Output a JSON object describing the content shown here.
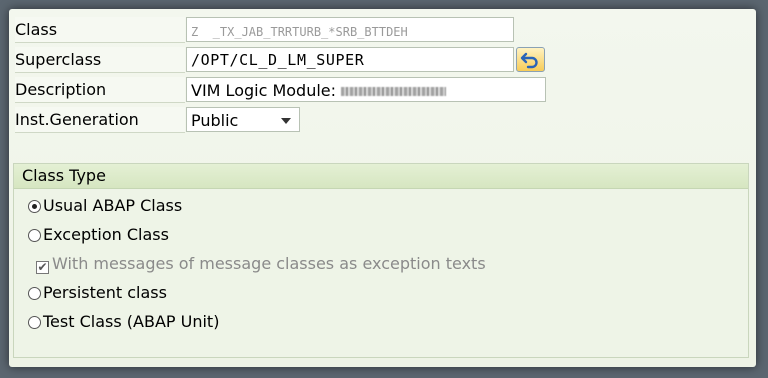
{
  "form": {
    "class": {
      "label": "Class",
      "value": "Z  _TX_JAB_TRRTURB_*SRB_BTTDEH"
    },
    "superclass": {
      "label": "Superclass",
      "value": "/OPT/CL_D_LM_SUPER",
      "undo_icon": "undo-arrow-icon"
    },
    "description": {
      "label": "Description",
      "value": "VIM Logic Module: "
    },
    "inst_generation": {
      "label": "Inst.Generation",
      "value": "Public"
    }
  },
  "class_type": {
    "title": "Class Type",
    "options": [
      {
        "label": "Usual ABAP Class",
        "selected": true
      },
      {
        "label": "Exception Class",
        "selected": false
      },
      {
        "label": "With messages of message classes as exception texts",
        "checked": true,
        "disabled": true
      },
      {
        "label": "Persistent class",
        "selected": false
      },
      {
        "label": "Test Class (ABAP Unit)",
        "selected": false
      }
    ]
  },
  "colors": {
    "panel_bg": "#eef4e7",
    "group_header": "#d6e6c1",
    "undo_button": "#f7cc58"
  }
}
